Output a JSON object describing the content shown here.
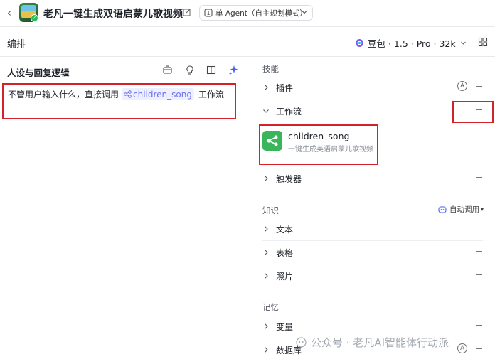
{
  "topbar": {
    "back_glyph": "‹",
    "app_title": "老凡一键生成双语启蒙儿歌视频",
    "agent_mode": "单 Agent（自主规划模式）"
  },
  "toolbar": {
    "section_title": "编排",
    "model_name": "豆包 · 1.5 · Pro · 32k"
  },
  "left_panel": {
    "heading": "人设与回复逻辑",
    "prompt_prefix": "不管用户输入什么，直接调用",
    "prompt_workflow": "children_song",
    "prompt_suffix": "工作流"
  },
  "right_panel": {
    "skills_label": "技能",
    "plugins_label": "插件",
    "workflow_label": "工作流",
    "workflow_card": {
      "name": "children_song",
      "description": "一键生成英语启蒙儿歌视频"
    },
    "trigger_label": "触发器",
    "knowledge_label": "知识",
    "auto_call_label": "自动调用",
    "text_label": "文本",
    "table_label": "表格",
    "photo_label": "照片",
    "memory_label": "记忆",
    "variable_label": "变量",
    "database_label": "数据库"
  },
  "watermark": {
    "text": "公众号 · 老凡AI智能体行动派"
  },
  "icons": {
    "back": "chevron-left-icon",
    "edit": "edit-icon",
    "agent": "agent-icon",
    "model": "doubao-logo-icon",
    "layout": "layout-grid-icon",
    "plus": "plus-icon",
    "chevron": "chevron-right-icon"
  },
  "colors": {
    "highlight_red": "#d4222a",
    "workflow_green": "#3ab55a",
    "chip_purple": "#6b73f0"
  }
}
